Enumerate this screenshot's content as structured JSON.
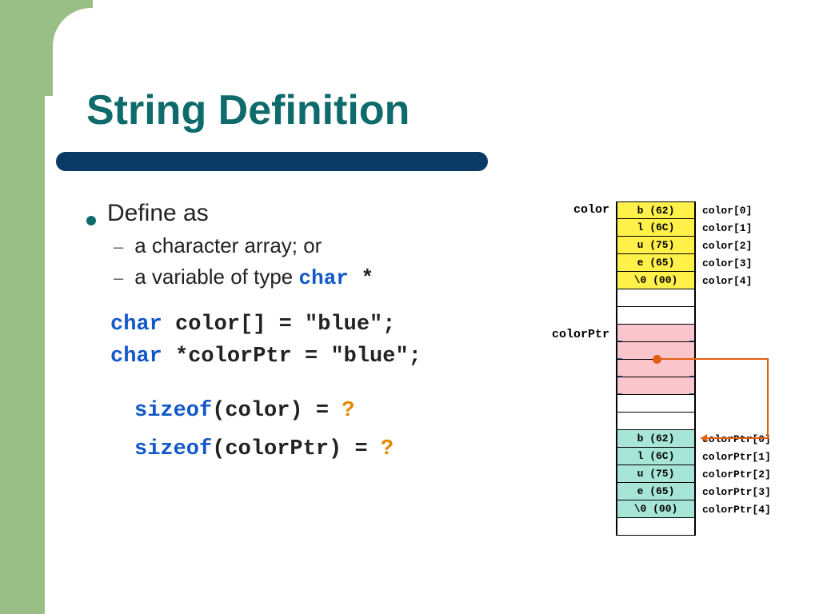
{
  "title": "String Definition",
  "bullets": {
    "define_as": "Define as",
    "sub1": "a character array; or",
    "sub2_pre": "a variable of type ",
    "sub2_kw": "char",
    "sub2_post": " *"
  },
  "decl": {
    "kw": "char",
    "line1_rest": " color[] = \"blue\";",
    "line2_rest": " *colorPtr = \"blue\";"
  },
  "sizeof": {
    "kw": "sizeof",
    "line1_paren": "(color) = ",
    "line2_paren": "(colorPtr) = ",
    "qmark": "?"
  },
  "mem": {
    "label_color": "color",
    "label_colorPtr": "colorPtr",
    "color_cells": [
      "b (62)",
      "l (6C)",
      "u (75)",
      "e (65)",
      "\\0 (00)"
    ],
    "color_idx": [
      "color[0]",
      "color[1]",
      "color[2]",
      "color[3]",
      "color[4]"
    ],
    "ptr_cells": [
      "b (62)",
      "l (6C)",
      "u (75)",
      "e (65)",
      "\\0 (00)"
    ],
    "ptr_idx": [
      "colorPtr[0]",
      "colorPtr[1]",
      "colorPtr[2]",
      "colorPtr[3]",
      "colorPtr[4]"
    ]
  }
}
